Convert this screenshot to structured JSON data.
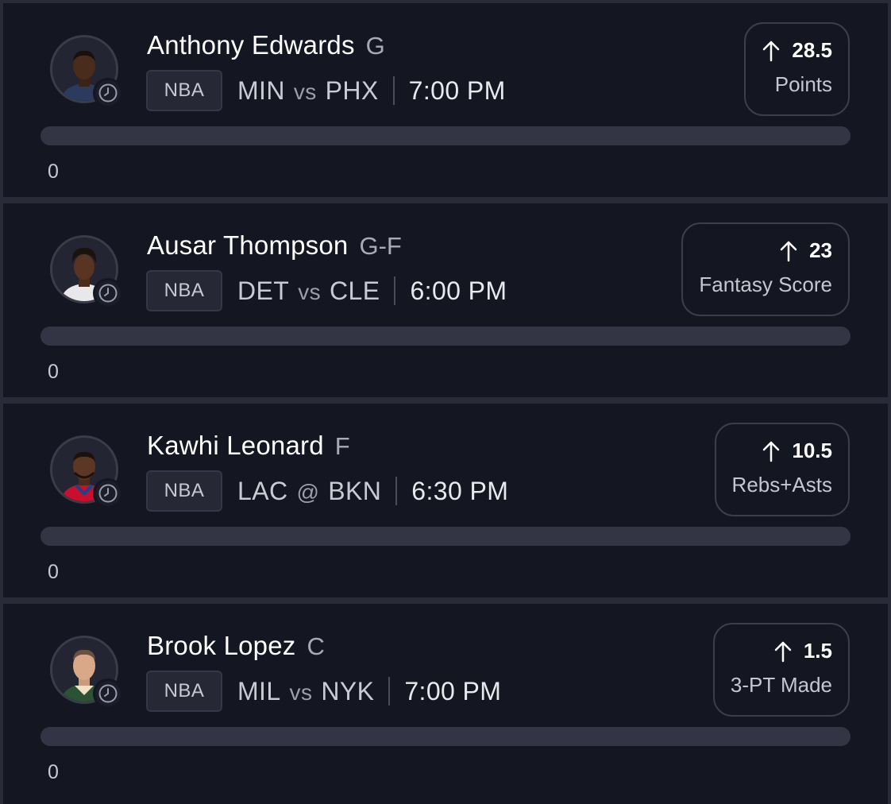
{
  "cards": [
    {
      "player": "Anthony Edwards",
      "position": "G",
      "league": "NBA",
      "team": "MIN",
      "separator": "vs",
      "opponent": "PHX",
      "time": "7:00 PM",
      "direction_icon": "arrow-up-icon",
      "line": "28.5",
      "stat": "Points",
      "progress_value": "0",
      "progress_fraction": 0,
      "jersey_color": "#2b3a5e"
    },
    {
      "player": "Ausar Thompson",
      "position": "G-F",
      "league": "NBA",
      "team": "DET",
      "separator": "vs",
      "opponent": "CLE",
      "time": "6:00 PM",
      "direction_icon": "arrow-up-icon",
      "line": "23",
      "stat": "Fantasy Score",
      "progress_value": "0",
      "progress_fraction": 0,
      "jersey_color": "#e8e8ec"
    },
    {
      "player": "Kawhi Leonard",
      "position": "F",
      "league": "NBA",
      "team": "LAC",
      "separator": "@",
      "opponent": "BKN",
      "time": "6:30 PM",
      "direction_icon": "arrow-up-icon",
      "line": "10.5",
      "stat": "Rebs+Asts",
      "progress_value": "0",
      "progress_fraction": 0,
      "jersey_color": "#c8102e"
    },
    {
      "player": "Brook Lopez",
      "position": "C",
      "league": "NBA",
      "team": "MIL",
      "separator": "vs",
      "opponent": "NYK",
      "time": "7:00 PM",
      "direction_icon": "arrow-up-icon",
      "line": "1.5",
      "stat": "3-PT Made",
      "progress_value": "0",
      "progress_fraction": 0,
      "jersey_color": "#2c5234"
    }
  ],
  "colors": {
    "background": "#141622",
    "separator": "#2a2b38",
    "progress_track": "#333544",
    "card_border": "#3c3e4c"
  }
}
